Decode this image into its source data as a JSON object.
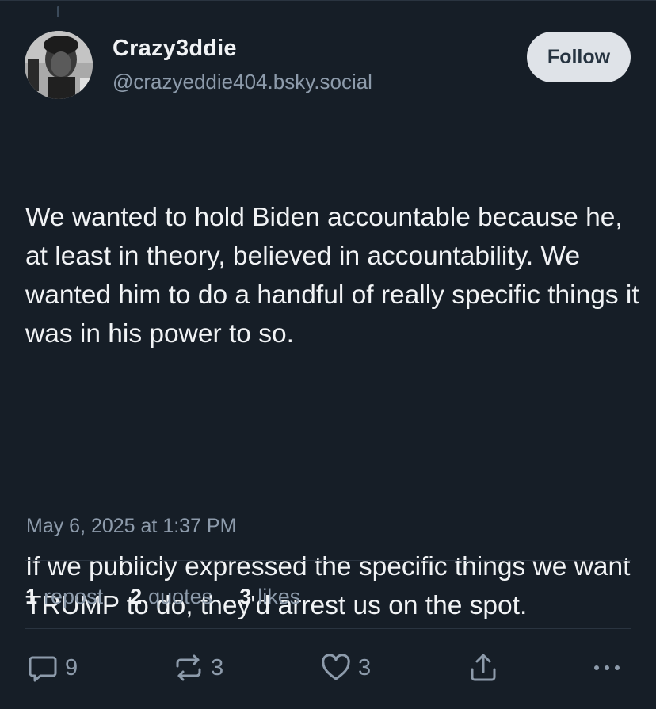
{
  "author": {
    "display_name": "Crazy3ddie",
    "handle": "@crazyeddie404.bsky.social"
  },
  "follow_button": {
    "label": "Follow"
  },
  "post": {
    "paragraphs": [
      "We wanted to hold Biden accountable because he, at least in theory, believed in accountability. We wanted him to do a handful of really specific things it was in his power to so.",
      "If we publicly expressed the specific things we want TRUMP to do, they'd arrest us on the spot."
    ],
    "timestamp": "May 6, 2025 at 1:37 PM"
  },
  "stats": {
    "reposts": {
      "count": "1",
      "label": "repost"
    },
    "quotes": {
      "count": "2",
      "label": "quotes"
    },
    "likes": {
      "count": "3",
      "label": "likes"
    }
  },
  "actions": {
    "reply": {
      "icon": "reply-icon",
      "count": "9"
    },
    "repost": {
      "icon": "repost-icon",
      "count": "3"
    },
    "like": {
      "icon": "heart-icon",
      "count": "3"
    },
    "share": {
      "icon": "share-icon"
    },
    "more": {
      "icon": "more-icon"
    }
  },
  "colors": {
    "background": "#161e27",
    "text": "#f1f3f5",
    "muted": "#8d9bab",
    "follow_bg": "#dfe3e8"
  }
}
